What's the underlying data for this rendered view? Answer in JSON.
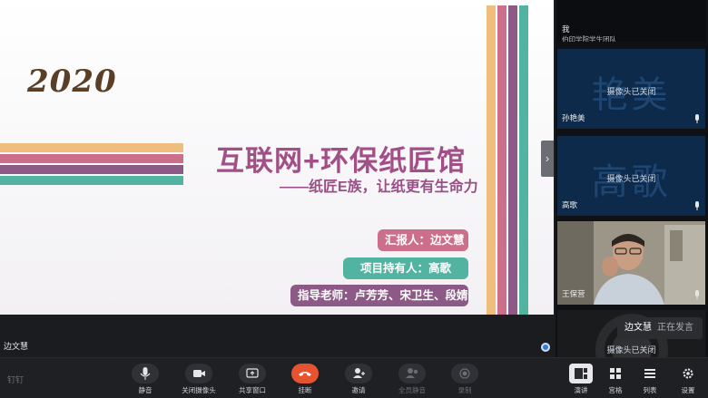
{
  "slide": {
    "year": "2020",
    "title": "互联网+环保纸匠馆",
    "subtitle": "——纸匠E族，让纸更有生命力",
    "reporter": "汇报人：边文慧",
    "holder": "项目持有人：高歌",
    "advisors": "指导老师：卢芳芳、宋卫生、段婧",
    "colors": {
      "orange": "#f0be7c",
      "pink": "#cc6f8b",
      "purple": "#8d5a87",
      "teal": "#52b3a0",
      "title": "#a24f87"
    }
  },
  "presenter": {
    "name": "边文慧"
  },
  "participants": [
    {
      "name": "我",
      "subtitle": "伯印学院学生团队",
      "camera_status": "",
      "big_name": ""
    },
    {
      "name": "孙艳美",
      "subtitle": "",
      "camera_status": "摄像头已关闭",
      "big_name": "艳美"
    },
    {
      "name": "高歌",
      "subtitle": "",
      "camera_status": "摄像头已关闭",
      "big_name": "高歌"
    },
    {
      "name": "王保营",
      "subtitle": "",
      "camera_status": "",
      "big_name": ""
    },
    {
      "name": "",
      "subtitle": "",
      "camera_status": "摄像头已关闭",
      "big_name": ""
    }
  ],
  "speaking_toast": {
    "name": "边文慧",
    "status": "正在发言"
  },
  "toolbar": {
    "brand": "钉钉",
    "mute": "静音",
    "camera_off": "关闭摄像头",
    "share": "共享窗口",
    "hangup": "挂断",
    "invite": "邀请",
    "mute_all": "全员静音",
    "record": "录制",
    "view_speaker": "演讲",
    "view_grid": "宫格",
    "view_list": "列表",
    "settings": "设置"
  }
}
